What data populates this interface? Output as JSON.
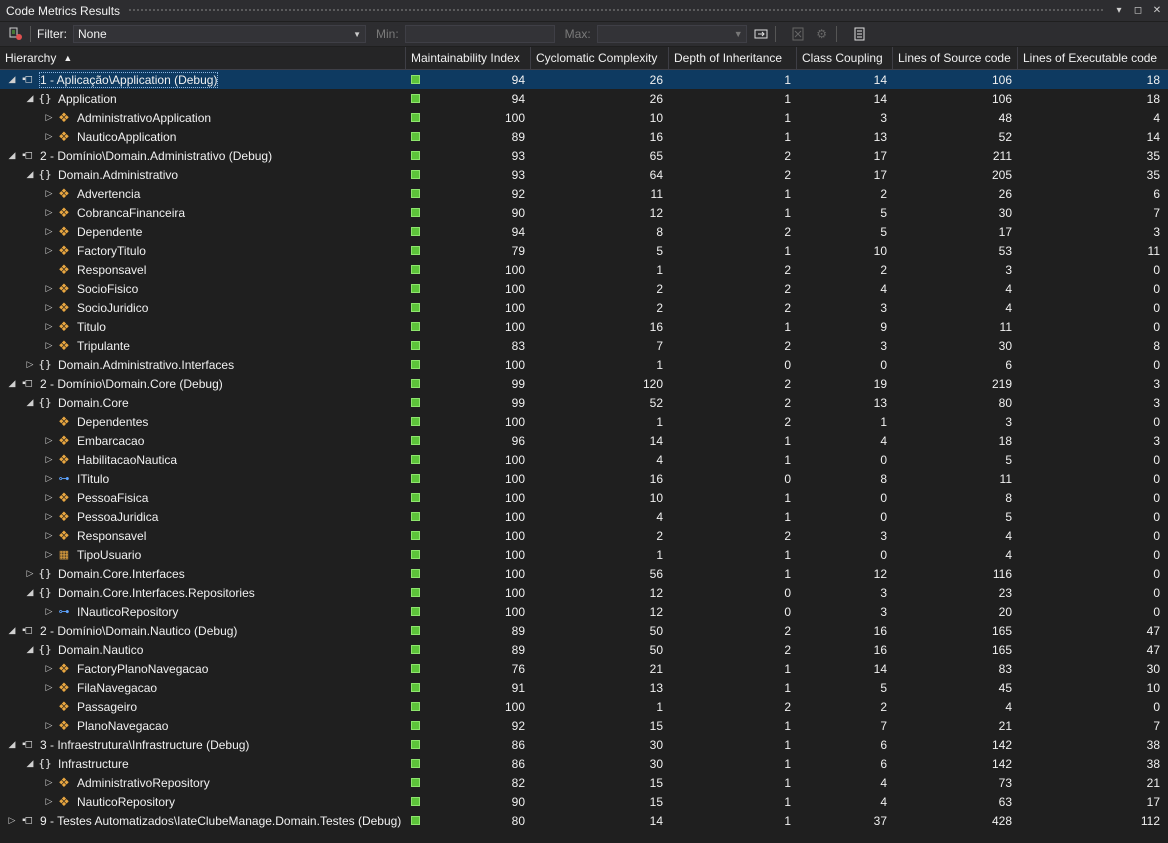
{
  "window": {
    "title": "Code Metrics Results",
    "controls": [
      "▾",
      "◻",
      "✕"
    ]
  },
  "toolbar": {
    "filter_label": "Filter:",
    "filter_value": "None",
    "min_label": "Min:",
    "max_label": "Max:"
  },
  "columns": [
    "Hierarchy",
    "Maintainability Index",
    "Cyclomatic Complexity",
    "Depth of Inheritance",
    "Class Coupling",
    "Lines of Source code",
    "Lines of Executable code"
  ],
  "rows": [
    {
      "level": 0,
      "expander": "◢",
      "icon": "assembly",
      "name": "1 - Aplicação\\Application (Debug)",
      "mi": "94",
      "cc": "26",
      "di": "1",
      "cp": "14",
      "ls": "106",
      "le": "18",
      "selected": true
    },
    {
      "level": 1,
      "expander": "◢",
      "icon": "namespace",
      "name": "Application",
      "mi": "94",
      "cc": "26",
      "di": "1",
      "cp": "14",
      "ls": "106",
      "le": "18"
    },
    {
      "level": 2,
      "expander": "▷",
      "icon": "class",
      "name": "AdministrativoApplication",
      "mi": "100",
      "cc": "10",
      "di": "1",
      "cp": "3",
      "ls": "48",
      "le": "4"
    },
    {
      "level": 2,
      "expander": "▷",
      "icon": "class",
      "name": "NauticoApplication",
      "mi": "89",
      "cc": "16",
      "di": "1",
      "cp": "13",
      "ls": "52",
      "le": "14"
    },
    {
      "level": 0,
      "expander": "◢",
      "icon": "assembly",
      "name": "2 - Domínio\\Domain.Administrativo (Debug)",
      "mi": "93",
      "cc": "65",
      "di": "2",
      "cp": "17",
      "ls": "211",
      "le": "35"
    },
    {
      "level": 1,
      "expander": "◢",
      "icon": "namespace",
      "name": "Domain.Administrativo",
      "mi": "93",
      "cc": "64",
      "di": "2",
      "cp": "17",
      "ls": "205",
      "le": "35"
    },
    {
      "level": 2,
      "expander": "▷",
      "icon": "class",
      "name": "Advertencia",
      "mi": "92",
      "cc": "11",
      "di": "1",
      "cp": "2",
      "ls": "26",
      "le": "6"
    },
    {
      "level": 2,
      "expander": "▷",
      "icon": "class",
      "name": "CobrancaFinanceira",
      "mi": "90",
      "cc": "12",
      "di": "1",
      "cp": "5",
      "ls": "30",
      "le": "7"
    },
    {
      "level": 2,
      "expander": "▷",
      "icon": "class",
      "name": "Dependente",
      "mi": "94",
      "cc": "8",
      "di": "2",
      "cp": "5",
      "ls": "17",
      "le": "3"
    },
    {
      "level": 2,
      "expander": "▷",
      "icon": "class",
      "name": "FactoryTitulo",
      "mi": "79",
      "cc": "5",
      "di": "1",
      "cp": "10",
      "ls": "53",
      "le": "11"
    },
    {
      "level": 2,
      "expander": "",
      "icon": "class",
      "name": "Responsavel",
      "mi": "100",
      "cc": "1",
      "di": "2",
      "cp": "2",
      "ls": "3",
      "le": "0"
    },
    {
      "level": 2,
      "expander": "▷",
      "icon": "class",
      "name": "SocioFisico",
      "mi": "100",
      "cc": "2",
      "di": "2",
      "cp": "4",
      "ls": "4",
      "le": "0"
    },
    {
      "level": 2,
      "expander": "▷",
      "icon": "class",
      "name": "SocioJuridico",
      "mi": "100",
      "cc": "2",
      "di": "2",
      "cp": "3",
      "ls": "4",
      "le": "0"
    },
    {
      "level": 2,
      "expander": "▷",
      "icon": "class",
      "name": "Titulo",
      "mi": "100",
      "cc": "16",
      "di": "1",
      "cp": "9",
      "ls": "11",
      "le": "0"
    },
    {
      "level": 2,
      "expander": "▷",
      "icon": "class",
      "name": "Tripulante",
      "mi": "83",
      "cc": "7",
      "di": "2",
      "cp": "3",
      "ls": "30",
      "le": "8"
    },
    {
      "level": 1,
      "expander": "▷",
      "icon": "namespace",
      "name": "Domain.Administrativo.Interfaces",
      "mi": "100",
      "cc": "1",
      "di": "0",
      "cp": "0",
      "ls": "6",
      "le": "0"
    },
    {
      "level": 0,
      "expander": "◢",
      "icon": "assembly",
      "name": "2 - Domínio\\Domain.Core (Debug)",
      "mi": "99",
      "cc": "120",
      "di": "2",
      "cp": "19",
      "ls": "219",
      "le": "3"
    },
    {
      "level": 1,
      "expander": "◢",
      "icon": "namespace",
      "name": "Domain.Core",
      "mi": "99",
      "cc": "52",
      "di": "2",
      "cp": "13",
      "ls": "80",
      "le": "3"
    },
    {
      "level": 2,
      "expander": "",
      "icon": "class",
      "name": "Dependentes",
      "mi": "100",
      "cc": "1",
      "di": "2",
      "cp": "1",
      "ls": "3",
      "le": "0"
    },
    {
      "level": 2,
      "expander": "▷",
      "icon": "class",
      "name": "Embarcacao",
      "mi": "96",
      "cc": "14",
      "di": "1",
      "cp": "4",
      "ls": "18",
      "le": "3"
    },
    {
      "level": 2,
      "expander": "▷",
      "icon": "class",
      "name": "HabilitacaoNautica",
      "mi": "100",
      "cc": "4",
      "di": "1",
      "cp": "0",
      "ls": "5",
      "le": "0"
    },
    {
      "level": 2,
      "expander": "▷",
      "icon": "interface",
      "name": "ITitulo",
      "mi": "100",
      "cc": "16",
      "di": "0",
      "cp": "8",
      "ls": "11",
      "le": "0"
    },
    {
      "level": 2,
      "expander": "▷",
      "icon": "class",
      "name": "PessoaFisica",
      "mi": "100",
      "cc": "10",
      "di": "1",
      "cp": "0",
      "ls": "8",
      "le": "0"
    },
    {
      "level": 2,
      "expander": "▷",
      "icon": "class",
      "name": "PessoaJuridica",
      "mi": "100",
      "cc": "4",
      "di": "1",
      "cp": "0",
      "ls": "5",
      "le": "0"
    },
    {
      "level": 2,
      "expander": "▷",
      "icon": "class",
      "name": "Responsavel",
      "mi": "100",
      "cc": "2",
      "di": "2",
      "cp": "3",
      "ls": "4",
      "le": "0"
    },
    {
      "level": 2,
      "expander": "▷",
      "icon": "enum",
      "name": "TipoUsuario",
      "mi": "100",
      "cc": "1",
      "di": "1",
      "cp": "0",
      "ls": "4",
      "le": "0"
    },
    {
      "level": 1,
      "expander": "▷",
      "icon": "namespace",
      "name": "Domain.Core.Interfaces",
      "mi": "100",
      "cc": "56",
      "di": "1",
      "cp": "12",
      "ls": "116",
      "le": "0"
    },
    {
      "level": 1,
      "expander": "◢",
      "icon": "namespace",
      "name": "Domain.Core.Interfaces.Repositories",
      "mi": "100",
      "cc": "12",
      "di": "0",
      "cp": "3",
      "ls": "23",
      "le": "0"
    },
    {
      "level": 2,
      "expander": "▷",
      "icon": "interface",
      "name": "INauticoRepository",
      "mi": "100",
      "cc": "12",
      "di": "0",
      "cp": "3",
      "ls": "20",
      "le": "0"
    },
    {
      "level": 0,
      "expander": "◢",
      "icon": "assembly",
      "name": "2 - Domínio\\Domain.Nautico (Debug)",
      "mi": "89",
      "cc": "50",
      "di": "2",
      "cp": "16",
      "ls": "165",
      "le": "47"
    },
    {
      "level": 1,
      "expander": "◢",
      "icon": "namespace",
      "name": "Domain.Nautico",
      "mi": "89",
      "cc": "50",
      "di": "2",
      "cp": "16",
      "ls": "165",
      "le": "47"
    },
    {
      "level": 2,
      "expander": "▷",
      "icon": "class",
      "name": "FactoryPlanoNavegacao",
      "mi": "76",
      "cc": "21",
      "di": "1",
      "cp": "14",
      "ls": "83",
      "le": "30"
    },
    {
      "level": 2,
      "expander": "▷",
      "icon": "class",
      "name": "FilaNavegacao",
      "mi": "91",
      "cc": "13",
      "di": "1",
      "cp": "5",
      "ls": "45",
      "le": "10"
    },
    {
      "level": 2,
      "expander": "",
      "icon": "class",
      "name": "Passageiro",
      "mi": "100",
      "cc": "1",
      "di": "2",
      "cp": "2",
      "ls": "4",
      "le": "0"
    },
    {
      "level": 2,
      "expander": "▷",
      "icon": "class",
      "name": "PlanoNavegacao",
      "mi": "92",
      "cc": "15",
      "di": "1",
      "cp": "7",
      "ls": "21",
      "le": "7"
    },
    {
      "level": 0,
      "expander": "◢",
      "icon": "assembly",
      "name": "3 - Infraestrutura\\Infrastructure (Debug)",
      "mi": "86",
      "cc": "30",
      "di": "1",
      "cp": "6",
      "ls": "142",
      "le": "38"
    },
    {
      "level": 1,
      "expander": "◢",
      "icon": "namespace",
      "name": "Infrastructure",
      "mi": "86",
      "cc": "30",
      "di": "1",
      "cp": "6",
      "ls": "142",
      "le": "38"
    },
    {
      "level": 2,
      "expander": "▷",
      "icon": "class",
      "name": "AdministrativoRepository",
      "mi": "82",
      "cc": "15",
      "di": "1",
      "cp": "4",
      "ls": "73",
      "le": "21"
    },
    {
      "level": 2,
      "expander": "▷",
      "icon": "class",
      "name": "NauticoRepository",
      "mi": "90",
      "cc": "15",
      "di": "1",
      "cp": "4",
      "ls": "63",
      "le": "17"
    },
    {
      "level": 0,
      "expander": "▷",
      "icon": "assembly",
      "name": "9 - Testes Automatizados\\IateClubeManage.Domain.Testes (Debug)",
      "mi": "80",
      "cc": "14",
      "di": "1",
      "cp": "37",
      "ls": "428",
      "le": "112"
    }
  ],
  "colors": {
    "background": "#1f1f1f",
    "selection": "#0e3a61",
    "maintainability_good": "#5dc43a"
  }
}
